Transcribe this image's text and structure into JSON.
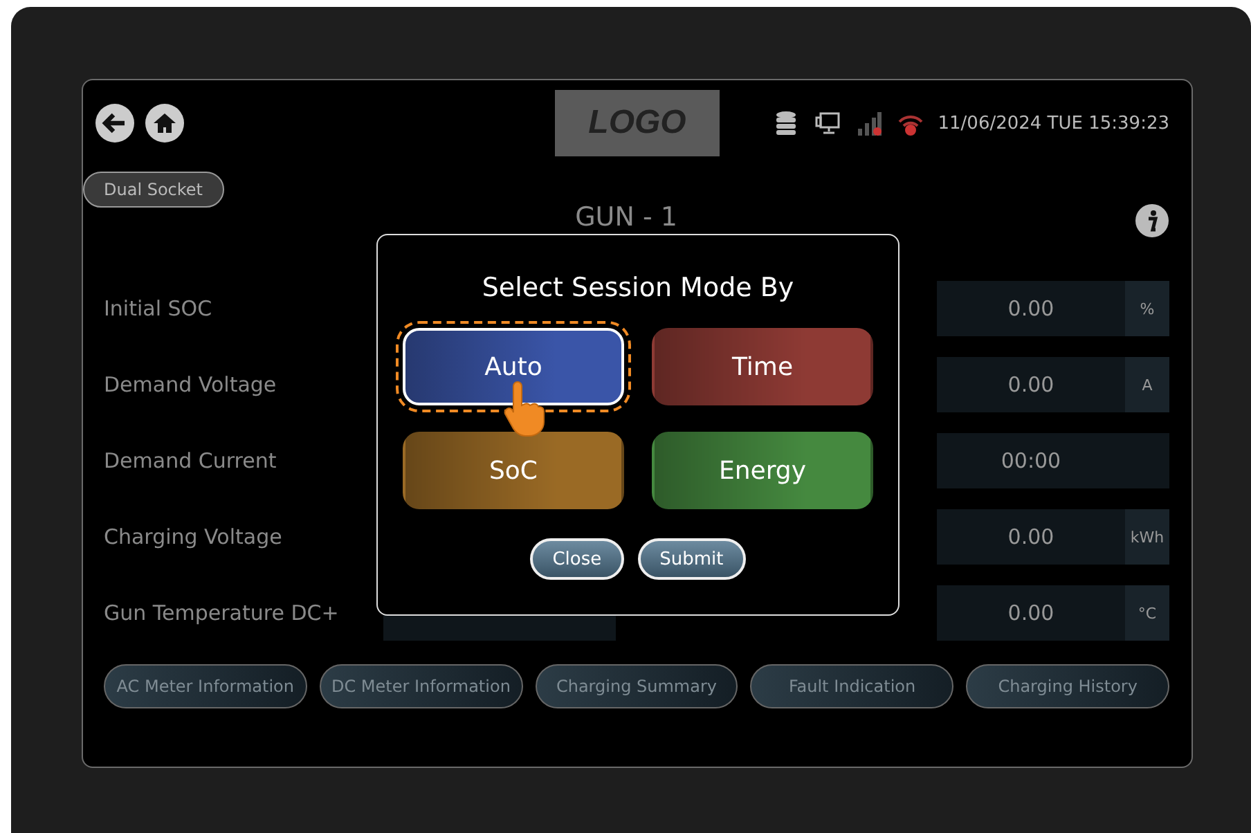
{
  "header": {
    "logo": "LOGO",
    "datetime": "11/06/2024 TUE 15:39:23"
  },
  "socket_button": "Dual Socket",
  "title": "GUN - 1",
  "rows": [
    {
      "label": "Initial SOC",
      "value": "0.00",
      "unit": "%"
    },
    {
      "label": "Demand Voltage",
      "value": "0.00",
      "unit": "A"
    },
    {
      "label": "Demand Current",
      "value": "00:00"
    },
    {
      "label": "Charging Voltage",
      "value": "0.00",
      "unit": "kWh"
    },
    {
      "label": "Gun Temperature DC+",
      "value": "0.00",
      "unit": "°C"
    }
  ],
  "bottom_buttons": [
    "AC Meter Information",
    "DC Meter Information",
    "Charging Summary",
    "Fault Indication",
    "Charging History"
  ],
  "dialog": {
    "title": "Select Session Mode By",
    "modes": [
      {
        "label": "Auto",
        "selected": true,
        "color": "#3a55a8"
      },
      {
        "label": "Time",
        "selected": false,
        "color": "#8e3a34"
      },
      {
        "label": "SoC",
        "selected": false,
        "color": "#9a6a25"
      },
      {
        "label": "Energy",
        "selected": false,
        "color": "#45893f"
      }
    ],
    "buttons": [
      "Close",
      "Submit"
    ]
  }
}
